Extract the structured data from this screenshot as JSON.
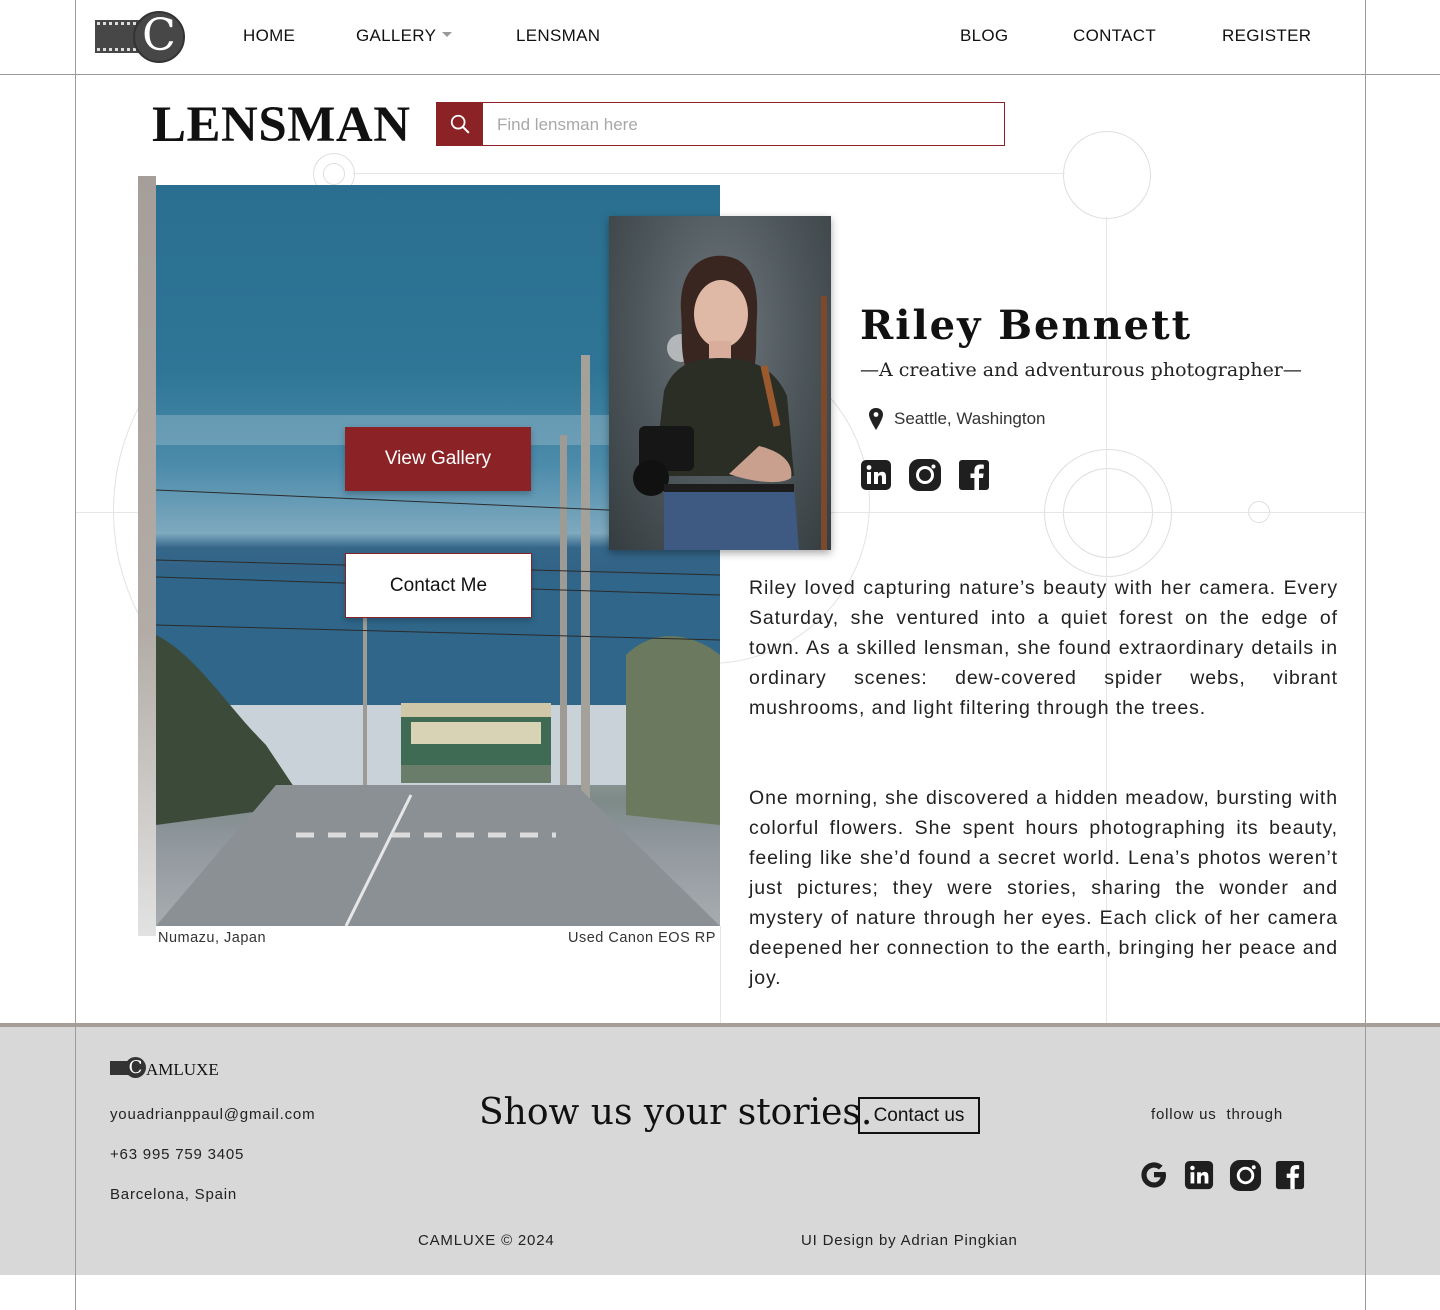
{
  "nav": {
    "brand_letter": "C",
    "items": [
      {
        "label": "HOME"
      },
      {
        "label": "GALLERY"
      },
      {
        "label": "LENSMAN"
      },
      {
        "label": "BLOG"
      },
      {
        "label": "CONTACT"
      },
      {
        "label": "REGISTER"
      }
    ]
  },
  "header": {
    "page_title": "LENSMAN",
    "search_placeholder": "Find lensman here"
  },
  "hero": {
    "view_gallery_label": "View Gallery",
    "contact_me_label": "Contact Me",
    "caption_location": "Numazu, Japan",
    "caption_camera": "Used Canon EOS RP"
  },
  "profile": {
    "name": "Riley Bennett",
    "tagline": "—A creative and adventurous photographer—",
    "location": "Seattle, Washington",
    "socials": [
      "linkedin-icon",
      "instagram-icon",
      "facebook-icon"
    ],
    "bio": [
      "Riley loved capturing nature’s beauty with her camera. Every Saturday, she ventured into a quiet forest on the edge of town. As a skilled lensman, she found extraordinary details in ordinary scenes: dew-covered spider webs, vibrant mushrooms, and light filtering through the trees.",
      "One morning, she discovered a hidden meadow, bursting with colorful flowers. She spent hours photographing its beauty, feeling like she’d found a secret world. Lena’s photos weren’t just pictures; they were stories, sharing the wonder and mystery of nature through her eyes. Each click of her camera deepened her connection to the earth, bringing her peace and joy."
    ]
  },
  "footer": {
    "brand_letter": "C",
    "brand_rest": "AMLUXE",
    "email": "youadrianppaul@gmail.com",
    "phone": "+63 995 759 3405",
    "address": "Barcelona, Spain",
    "cta_text": "Show us your stories.",
    "cta_button": "Contact us",
    "follow_text": "follow us  through",
    "socials": [
      "google-icon",
      "linkedin-icon",
      "instagram-icon",
      "facebook-icon"
    ],
    "copyright": "CAMLUXE © 2024",
    "credit": "UI Design by Adrian Pingkian"
  },
  "colors": {
    "accent": "#8a2226",
    "footer_bg": "#d8d8d8",
    "footer_border": "#a69f99",
    "sidebar_bar": "#a69f99"
  }
}
